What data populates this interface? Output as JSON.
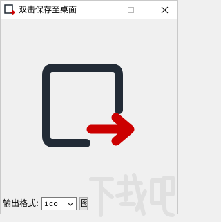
{
  "window": {
    "title": "双击保存至桌面",
    "app_icon": "export-arrow-icon",
    "controls": {
      "minimize_icon": "minimize-icon",
      "maximize_icon": "maximize-icon",
      "close_icon": "close-icon",
      "maximize_enabled": false
    }
  },
  "main": {
    "graphic_icon": "export-box-arrow-icon",
    "graphic_colors": {
      "frame": "#222b36",
      "arrow": "#cc0000"
    }
  },
  "footer": {
    "format_label": "输出格式:",
    "format_select": {
      "selected": "ico"
    },
    "extra_button_label": "图"
  },
  "watermark": {
    "text": "下载吧",
    "icon": "site-logo-icon"
  }
}
